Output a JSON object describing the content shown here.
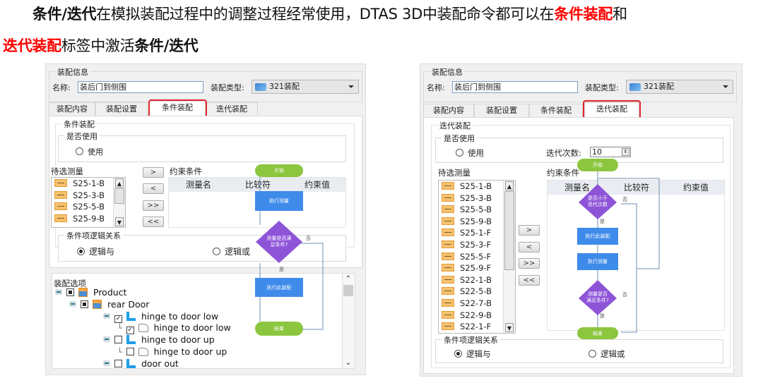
{
  "headline": {
    "line1": [
      {
        "text": "条件/迭代",
        "style": "bold"
      },
      {
        "text": "在模拟装配过程中的调整过程经常使用，DTAS 3D中装配命令都可以在",
        "style": "normal"
      },
      {
        "text": "条件装配",
        "style": "red"
      },
      {
        "text": "和",
        "style": "normal"
      }
    ],
    "line2": [
      {
        "text": "迭代装配",
        "style": "red"
      },
      {
        "text": "标签中激活",
        "style": "normal"
      },
      {
        "text": "条件/迭代",
        "style": "bold"
      }
    ]
  },
  "highlight_color": "#e0262e",
  "left_panel": {
    "info_group_label": "装配信息",
    "name_label": "名称:",
    "name_value": "装后门到侧围",
    "type_label": "装配类型:",
    "type_value": "321装配",
    "tabs": [
      "装配内容",
      "装配设置",
      "条件装配",
      "迭代装配"
    ],
    "active_tab": "条件装配",
    "section_label": "条件装配",
    "use_group_label": "是否使用",
    "use_radio_label": "使用",
    "candidate_label": "待选测量",
    "candidates": [
      "S25-1-B",
      "S25-3-B",
      "S25-5-B",
      "S25-9-B"
    ],
    "move_buttons": [
      ">",
      "<",
      ">>",
      "<<"
    ],
    "constraint_label": "约束条件",
    "constraint_columns": [
      "测量名",
      "比较符",
      "约束值"
    ],
    "logic_group_label": "条件项逻辑关系",
    "logic_and": "逻辑与",
    "logic_or": "逻辑或",
    "logic_selected": "逻辑与",
    "options_label": "装配选项",
    "tree": [
      {
        "label": "Product",
        "level": 0,
        "check": "partial",
        "icon": "assembly"
      },
      {
        "label": "rear Door",
        "level": 1,
        "check": "partial",
        "icon": "assembly"
      },
      {
        "label": "hinge to door low",
        "level": 2,
        "check": "checked",
        "icon": "part"
      },
      {
        "label": "hinge to door low",
        "level": 3,
        "check": "checked",
        "icon": "constraint"
      },
      {
        "label": "hinge to door up",
        "level": 2,
        "check": "unchecked",
        "icon": "part"
      },
      {
        "label": "hinge to door up",
        "level": 3,
        "check": "unchecked",
        "icon": "constraint"
      },
      {
        "label": "door out",
        "level": 2,
        "check": "unchecked",
        "icon": "part"
      }
    ],
    "flowchart": {
      "start": "开始",
      "measure": "执行测量",
      "decision": "测量是否满足条件?",
      "yes": "是",
      "no": "否",
      "assemble": "执行此装配",
      "end": "结束"
    }
  },
  "right_panel": {
    "info_group_label": "装配信息",
    "name_label": "名称:",
    "name_value": "装后门到侧围",
    "type_label": "装配类型:",
    "type_value": "321装配",
    "tabs": [
      "装配内容",
      "装配设置",
      "条件装配",
      "迭代装配"
    ],
    "active_tab": "迭代装配",
    "section_label": "迭代装配",
    "use_group_label": "是否使用",
    "use_radio_label": "使用",
    "iter_count_label": "迭代次数:",
    "iter_count_value": "10",
    "candidate_label": "待选测量",
    "candidates": [
      "S25-1-B",
      "S25-3-B",
      "S25-5-B",
      "S25-9-B",
      "S25-1-F",
      "S25-3-F",
      "S25-5-F",
      "S25-9-F",
      "S22-1-B",
      "S22-5-B",
      "S22-7-B",
      "S22-9-B",
      "S22-1-F"
    ],
    "move_buttons": [
      ">",
      "<",
      ">>",
      "<<"
    ],
    "constraint_label": "约束条件",
    "constraint_columns": [
      "测量名",
      "比较符",
      "约束值"
    ],
    "logic_group_label": "条件项逻辑关系",
    "logic_and": "逻辑与",
    "logic_or": "逻辑或",
    "logic_selected": "逻辑与",
    "flowchart": {
      "start": "开始",
      "iter_check": "是否小于迭代次数",
      "assemble": "执行此装配",
      "measure": "执行测量",
      "decision": "测量是否满足条件?",
      "yes": "是",
      "no": "否",
      "end": "结束"
    }
  }
}
